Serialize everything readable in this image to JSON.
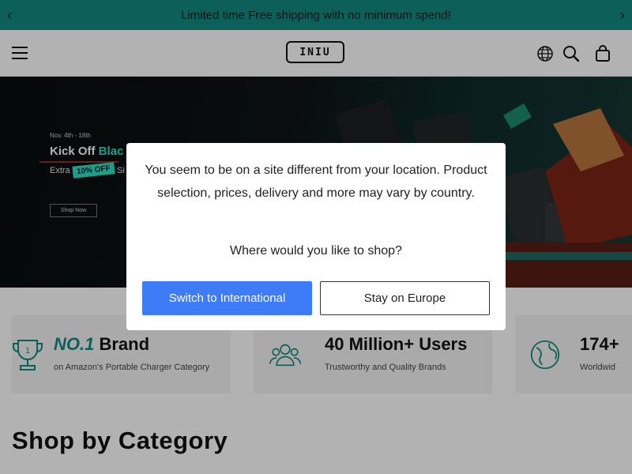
{
  "announcement": {
    "text": "Limited time Free shipping with no minimum spend!",
    "prev_glyph": "‹",
    "next_glyph": "›"
  },
  "header": {
    "logo_text": "INIU",
    "icons": [
      "menu-icon",
      "globe-icon",
      "search-icon",
      "bag-icon"
    ]
  },
  "hero": {
    "date": "Nov. 4th - 18th",
    "title_prefix": "Kick Off ",
    "title_accent": "Blac",
    "extra": "Extra",
    "badge": "10% OFF",
    "extra_suffix": "Si",
    "shop_button": "Shop Now"
  },
  "features": [
    {
      "highlight": "NO.1",
      "title": " Brand",
      "subtitle": "on Amazon's Portable Charger Category"
    },
    {
      "highlight": "",
      "title": "40 Million+ Users",
      "subtitle": "Trustworthy and Quality Brands"
    },
    {
      "highlight": "",
      "title": "174+",
      "subtitle": "Worldwid"
    }
  ],
  "section_title": "Shop by Category",
  "modal": {
    "message": "You seem to be on a site different from your location. Product selection, prices, delivery and more may vary by country.",
    "question": "Where would you like to shop?",
    "primary_button": "Switch to International",
    "secondary_button": "Stay on Europe"
  },
  "colors": {
    "teal": "#138a80",
    "accent": "#2ee0c6",
    "primary_button": "#3d7bf7"
  }
}
